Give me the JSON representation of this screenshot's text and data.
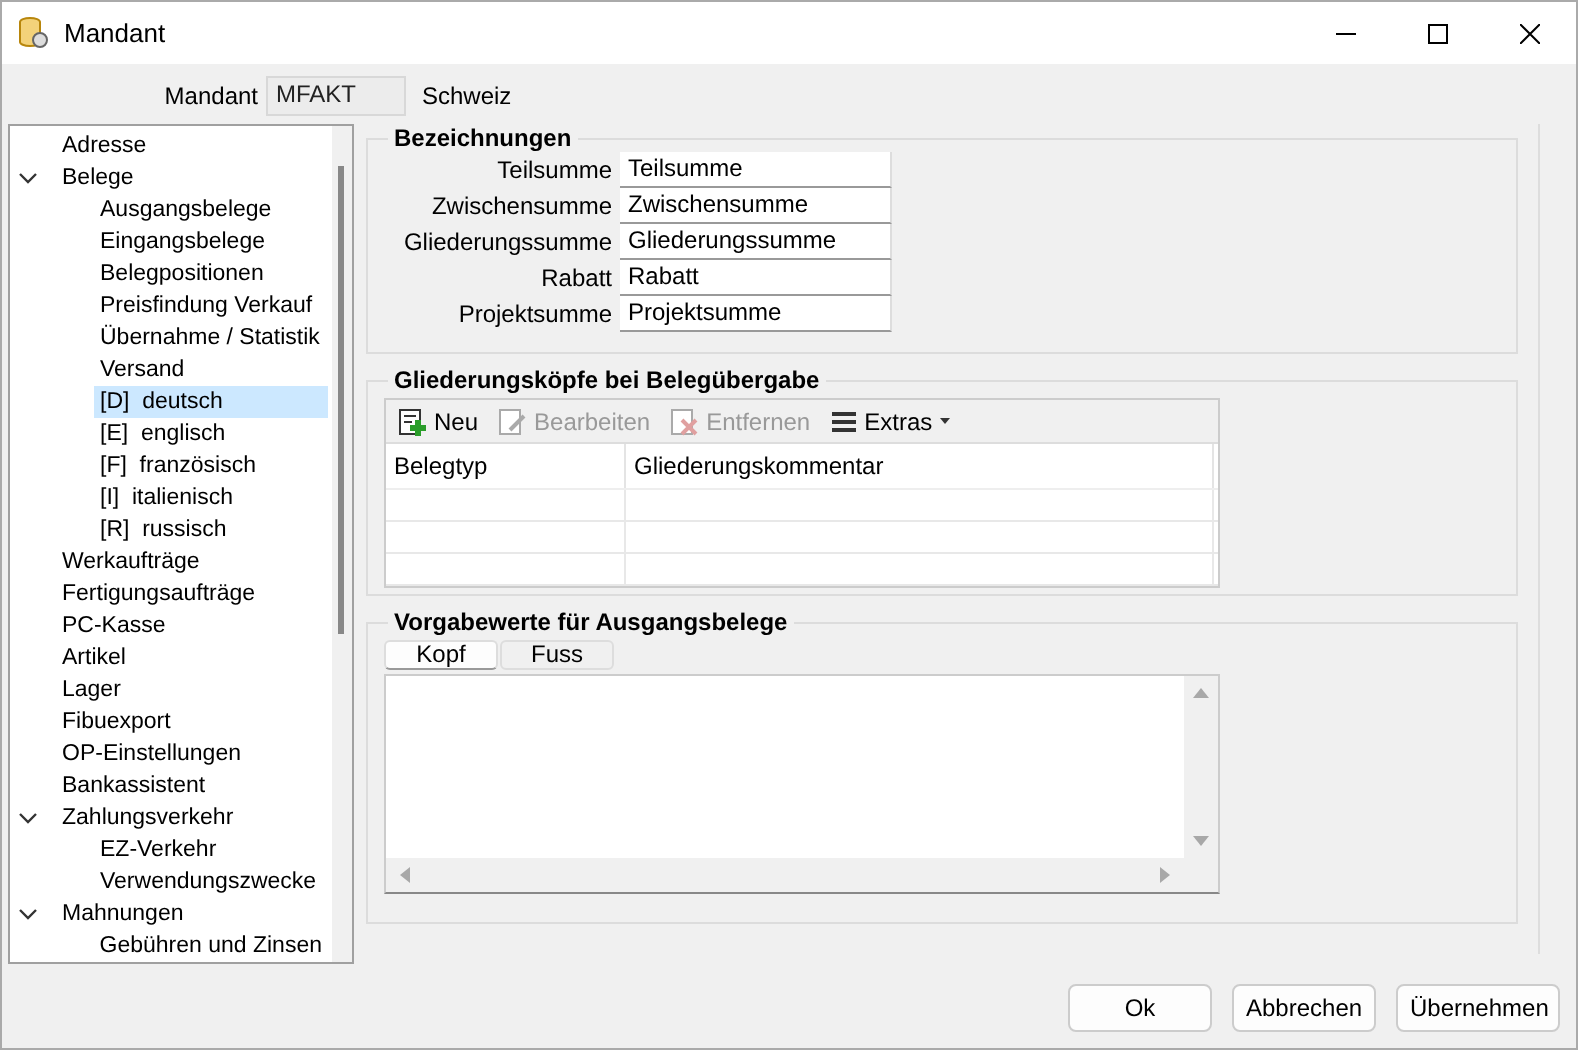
{
  "window": {
    "title": "Mandant"
  },
  "mandant": {
    "label": "Mandant",
    "value": "MFAKT",
    "name": "Schweiz"
  },
  "tree": [
    {
      "label": "Adresse",
      "selected": false
    },
    {
      "label": "Belege",
      "selected": false,
      "expanded": true,
      "children": [
        {
          "label": "Ausgangsbelege",
          "selected": false
        },
        {
          "label": "Eingangsbelege",
          "selected": false
        },
        {
          "label": "Belegpositionen",
          "selected": false
        },
        {
          "label": "Preisfindung Verkauf",
          "selected": false
        },
        {
          "label": "Übernahme / Statistik",
          "selected": false
        },
        {
          "label": "Versand",
          "selected": false
        },
        {
          "label": "[D]  deutsch",
          "selected": true
        },
        {
          "label": "[E]  englisch",
          "selected": false
        },
        {
          "label": "[F]  französisch",
          "selected": false
        },
        {
          "label": "[I]  italienisch",
          "selected": false
        },
        {
          "label": "[R]  russisch",
          "selected": false
        }
      ]
    },
    {
      "label": "Werkaufträge",
      "selected": false
    },
    {
      "label": "Fertigungsaufträge",
      "selected": false
    },
    {
      "label": "PC-Kasse",
      "selected": false
    },
    {
      "label": "Artikel",
      "selected": false
    },
    {
      "label": "Lager",
      "selected": false
    },
    {
      "label": "Fibuexport",
      "selected": false
    },
    {
      "label": "OP-Einstellungen",
      "selected": false
    },
    {
      "label": "Bankassistent",
      "selected": false
    },
    {
      "label": "Zahlungsverkehr",
      "selected": false,
      "expanded": true,
      "children": [
        {
          "label": "EZ-Verkehr",
          "selected": false
        },
        {
          "label": "Verwendungszwecke",
          "selected": false
        }
      ]
    },
    {
      "label": "Mahnungen",
      "selected": false,
      "expanded": true,
      "children": [
        {
          "label": "Gebühren und Zinsen",
          "selected": false
        }
      ]
    }
  ],
  "bezeichnungen": {
    "title": "Bezeichnungen",
    "fields": [
      {
        "label": "Teilsumme",
        "value": "Teilsumme"
      },
      {
        "label": "Zwischensumme",
        "value": "Zwischensumme"
      },
      {
        "label": "Gliederungssumme",
        "value": "Gliederungssumme"
      },
      {
        "label": "Rabatt",
        "value": "Rabatt"
      },
      {
        "label": "Projektsumme",
        "value": "Projektsumme"
      }
    ]
  },
  "gliederung": {
    "title": "Gliederungsköpfe bei Belegübergabe",
    "toolbar": [
      {
        "kind": "new",
        "label": "Neu",
        "disabled": false
      },
      {
        "kind": "edit",
        "label": "Bearbeiten",
        "disabled": true
      },
      {
        "kind": "delete",
        "label": "Entfernen",
        "disabled": true
      },
      {
        "kind": "menu",
        "label": "Extras",
        "disabled": false
      }
    ],
    "columns": [
      "Belegtyp",
      "Gliederungskommentar"
    ]
  },
  "vorgabe": {
    "title": "Vorgabewerte für Ausgangsbelege",
    "tabs": [
      {
        "label": "Kopf",
        "selected": true
      },
      {
        "label": "Fuss",
        "selected": false
      }
    ]
  },
  "buttons": [
    "Ok",
    "Abbrechen",
    "Übernehmen"
  ]
}
